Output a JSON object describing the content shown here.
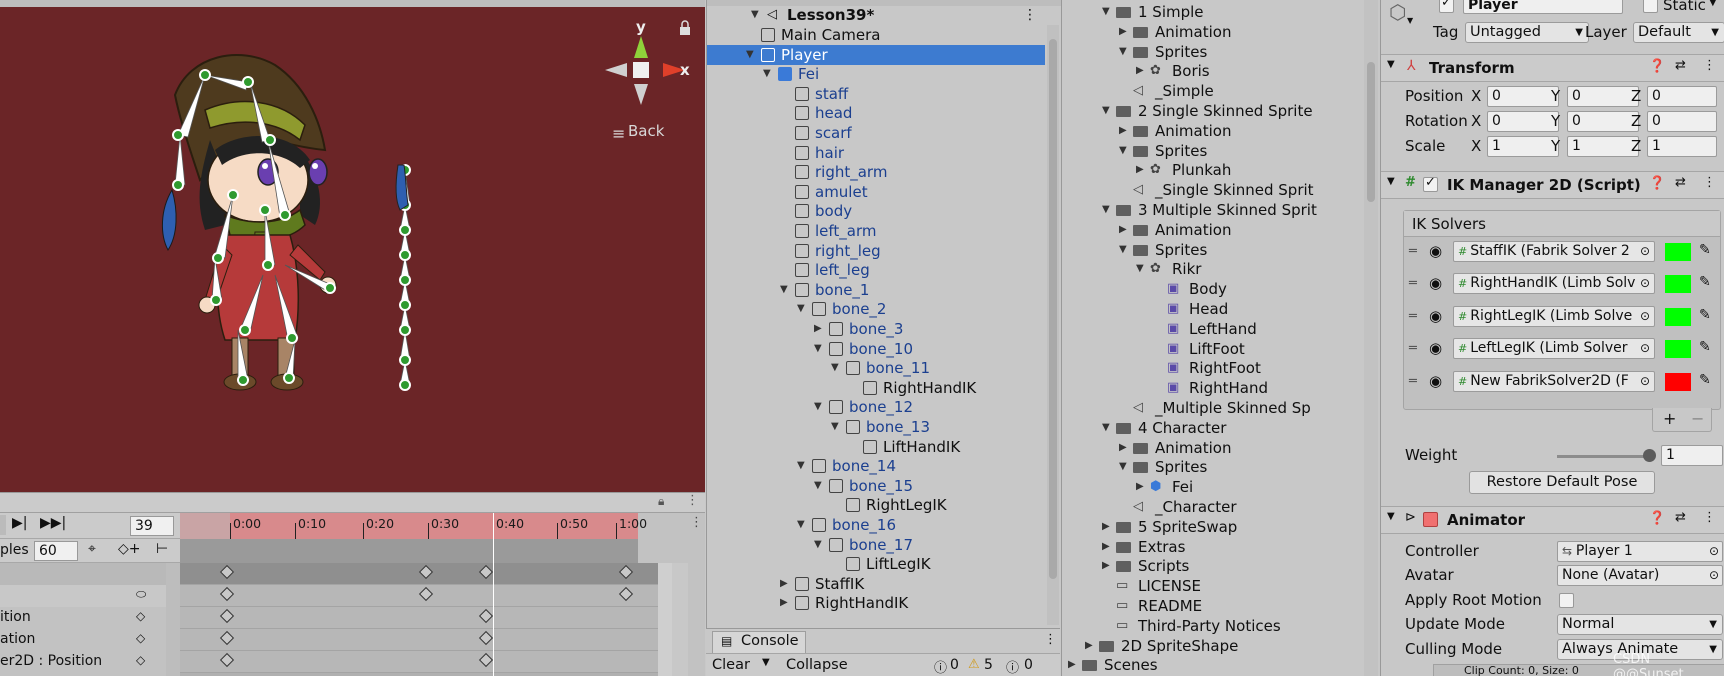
{
  "scene": {
    "back_label": "Back",
    "gizmo": {
      "y": "y",
      "x": "x"
    }
  },
  "animation": {
    "current_frame": "39",
    "samples_label": "ples",
    "samples_value": "60",
    "ruler_ticks": [
      "0:00",
      "0:10",
      "0:20",
      "0:30",
      "0:40",
      "0:50",
      "1:00"
    ],
    "properties": [
      "ition",
      "ation",
      "er2D : Position"
    ]
  },
  "hierarchy": {
    "scene_name": "Lesson39*",
    "items": [
      {
        "label": "Main Camera",
        "depth": 1,
        "arrow": "",
        "blue": false,
        "selected": false
      },
      {
        "label": "Player",
        "depth": 1,
        "arrow": "▼",
        "blue": false,
        "selected": true
      },
      {
        "label": "Fei",
        "depth": 2,
        "arrow": "▼",
        "blue": true,
        "selected": false,
        "prefab": true
      },
      {
        "label": "staff",
        "depth": 3,
        "arrow": "",
        "blue": true
      },
      {
        "label": "head",
        "depth": 3,
        "arrow": "",
        "blue": true
      },
      {
        "label": "scarf",
        "depth": 3,
        "arrow": "",
        "blue": true
      },
      {
        "label": "hair",
        "depth": 3,
        "arrow": "",
        "blue": true
      },
      {
        "label": "right_arm",
        "depth": 3,
        "arrow": "",
        "blue": true
      },
      {
        "label": "amulet",
        "depth": 3,
        "arrow": "",
        "blue": true
      },
      {
        "label": "body",
        "depth": 3,
        "arrow": "",
        "blue": true
      },
      {
        "label": "left_arm",
        "depth": 3,
        "arrow": "",
        "blue": true
      },
      {
        "label": "right_leg",
        "depth": 3,
        "arrow": "",
        "blue": true
      },
      {
        "label": "left_leg",
        "depth": 3,
        "arrow": "",
        "blue": true
      },
      {
        "label": "bone_1",
        "depth": 3,
        "arrow": "▼",
        "blue": true
      },
      {
        "label": "bone_2",
        "depth": 4,
        "arrow": "▼",
        "blue": true
      },
      {
        "label": "bone_3",
        "depth": 5,
        "arrow": "▶",
        "blue": true
      },
      {
        "label": "bone_10",
        "depth": 5,
        "arrow": "▼",
        "blue": true
      },
      {
        "label": "bone_11",
        "depth": 6,
        "arrow": "▼",
        "blue": true
      },
      {
        "label": "RightHandIK",
        "depth": 7,
        "arrow": "",
        "blue": false,
        "ik": true
      },
      {
        "label": "bone_12",
        "depth": 5,
        "arrow": "▼",
        "blue": true
      },
      {
        "label": "bone_13",
        "depth": 6,
        "arrow": "▼",
        "blue": true
      },
      {
        "label": "LiftHandIK",
        "depth": 7,
        "arrow": "",
        "blue": false,
        "ik": true
      },
      {
        "label": "bone_14",
        "depth": 4,
        "arrow": "▼",
        "blue": true
      },
      {
        "label": "bone_15",
        "depth": 5,
        "arrow": "▼",
        "blue": true
      },
      {
        "label": "RightLegIK",
        "depth": 6,
        "arrow": "",
        "blue": false,
        "ik": true
      },
      {
        "label": "bone_16",
        "depth": 4,
        "arrow": "▼",
        "blue": true
      },
      {
        "label": "bone_17",
        "depth": 5,
        "arrow": "▼",
        "blue": true
      },
      {
        "label": "LiftLegIK",
        "depth": 6,
        "arrow": "",
        "blue": false,
        "ik": true
      },
      {
        "label": "StaffIK",
        "depth": 3,
        "arrow": "▶",
        "blue": false,
        "ik": true
      },
      {
        "label": "RightHandIK",
        "depth": 3,
        "arrow": "▶",
        "blue": false,
        "ik": true
      }
    ]
  },
  "console": {
    "tab": "Console",
    "clear": "Clear",
    "collapse": "Collapse",
    "errors": "0",
    "warnings": "5",
    "infos": "0"
  },
  "project": {
    "items": [
      {
        "label": "1 Simple",
        "indent": 0,
        "arrow": "▼",
        "icon": "folder"
      },
      {
        "label": "Animation",
        "indent": 1,
        "arrow": "▶",
        "icon": "folder"
      },
      {
        "label": "Sprites",
        "indent": 1,
        "arrow": "▼",
        "icon": "folder"
      },
      {
        "label": "Boris",
        "indent": 2,
        "arrow": "▶",
        "icon": "sprite"
      },
      {
        "label": "_Simple",
        "indent": 1,
        "arrow": "",
        "icon": "scene"
      },
      {
        "label": "2 Single Skinned Sprite",
        "indent": 0,
        "arrow": "▼",
        "icon": "folder"
      },
      {
        "label": "Animation",
        "indent": 1,
        "arrow": "▶",
        "icon": "folder"
      },
      {
        "label": "Sprites",
        "indent": 1,
        "arrow": "▼",
        "icon": "folder"
      },
      {
        "label": "Plunkah",
        "indent": 2,
        "arrow": "▶",
        "icon": "sprite"
      },
      {
        "label": "_Single Skinned Sprit",
        "indent": 1,
        "arrow": "",
        "icon": "scene"
      },
      {
        "label": "3 Multiple Skinned Sprit",
        "indent": 0,
        "arrow": "▼",
        "icon": "folder"
      },
      {
        "label": "Animation",
        "indent": 1,
        "arrow": "▶",
        "icon": "folder"
      },
      {
        "label": "Sprites",
        "indent": 1,
        "arrow": "▼",
        "icon": "folder"
      },
      {
        "label": "Rikr",
        "indent": 2,
        "arrow": "▼",
        "icon": "sprite"
      },
      {
        "label": "Body",
        "indent": 3,
        "arrow": "",
        "icon": "bone"
      },
      {
        "label": "Head",
        "indent": 3,
        "arrow": "",
        "icon": "bone"
      },
      {
        "label": "LeftHand",
        "indent": 3,
        "arrow": "",
        "icon": "bone"
      },
      {
        "label": "LiftFoot",
        "indent": 3,
        "arrow": "",
        "icon": "bone"
      },
      {
        "label": "RightFoot",
        "indent": 3,
        "arrow": "",
        "icon": "bone"
      },
      {
        "label": "RightHand",
        "indent": 3,
        "arrow": "",
        "icon": "bone"
      },
      {
        "label": "_Multiple Skinned Sp",
        "indent": 1,
        "arrow": "",
        "icon": "scene"
      },
      {
        "label": "4 Character",
        "indent": 0,
        "arrow": "▼",
        "icon": "folder"
      },
      {
        "label": "Animation",
        "indent": 1,
        "arrow": "▶",
        "icon": "folder"
      },
      {
        "label": "Sprites",
        "indent": 1,
        "arrow": "▼",
        "icon": "folder"
      },
      {
        "label": "Fei",
        "indent": 2,
        "arrow": "▶",
        "icon": "prefab"
      },
      {
        "label": "_Character",
        "indent": 1,
        "arrow": "",
        "icon": "scene"
      },
      {
        "label": "5 SpriteSwap",
        "indent": 0,
        "arrow": "▶",
        "icon": "folder"
      },
      {
        "label": "Extras",
        "indent": 0,
        "arrow": "▶",
        "icon": "folder"
      },
      {
        "label": "Scripts",
        "indent": 0,
        "arrow": "▶",
        "icon": "folder"
      },
      {
        "label": "LICENSE",
        "indent": 0,
        "arrow": "",
        "icon": "doc"
      },
      {
        "label": "README",
        "indent": 0,
        "arrow": "",
        "icon": "doc"
      },
      {
        "label": "Third-Party Notices",
        "indent": 0,
        "arrow": "",
        "icon": "doc"
      },
      {
        "label": "2D SpriteShape",
        "indent": -1,
        "arrow": "▶",
        "icon": "folder"
      },
      {
        "label": "Scenes",
        "indent": -2,
        "arrow": "▶",
        "icon": "folder"
      }
    ]
  },
  "inspector": {
    "object_name": "Player",
    "static_label": "Static",
    "tag_label": "Tag",
    "tag_value": "Untagged",
    "layer_label": "Layer",
    "layer_value": "Default",
    "transform": {
      "title": "Transform",
      "position_label": "Position",
      "rotation_label": "Rotation",
      "scale_label": "Scale",
      "axis_x": "X",
      "axis_y": "Y",
      "axis_z": "Z",
      "position": [
        "0",
        "0",
        "0"
      ],
      "rotation": [
        "0",
        "0",
        "0"
      ],
      "scale": [
        "1",
        "1",
        "1"
      ]
    },
    "ik_manager": {
      "title": "IK Manager 2D (Script)",
      "solvers_label": "IK Solvers",
      "solvers": [
        {
          "name": "StaffIK (Fabrik Solver 2",
          "color": "#00ff00"
        },
        {
          "name": "RightHandIK (Limb Solv",
          "color": "#00ff00"
        },
        {
          "name": "RightLegIK (Limb Solve",
          "color": "#00ff00"
        },
        {
          "name": "LeftLegIK (Limb Solver",
          "color": "#00ff00"
        },
        {
          "name": "New FabrikSolver2D (F",
          "color": "#ff0000"
        }
      ],
      "weight_label": "Weight",
      "weight_value": "1",
      "restore_button": "Restore Default Pose"
    },
    "animator": {
      "title": "Animator",
      "controller_label": "Controller",
      "controller_value": "Player 1",
      "avatar_label": "Avatar",
      "avatar_value": "None (Avatar)",
      "apply_root_label": "Apply Root Motion",
      "update_mode_label": "Update Mode",
      "update_mode_value": "Normal",
      "culling_mode_label": "Culling Mode",
      "culling_mode_value": "Always Animate",
      "clip_info": "Clip Count: 0, Size: 0"
    },
    "watermark": "CSDN @@Sunset..."
  },
  "colors": {
    "scene_bg": "#6b2527",
    "selection": "#3d7bd0",
    "ruler": "#d88a8c",
    "ik_green": "#00ff00",
    "ik_red": "#ff0000"
  }
}
